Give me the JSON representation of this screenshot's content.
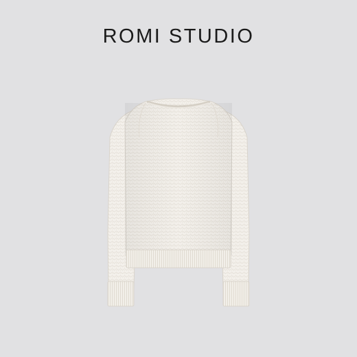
{
  "brand": {
    "name": "ROMI STUDIO"
  },
  "product": {
    "icon": "knit-sweater-image",
    "color": "#f3f0ea"
  },
  "colors": {
    "background": "#e1e1e3",
    "text": "#1a1a1a"
  }
}
